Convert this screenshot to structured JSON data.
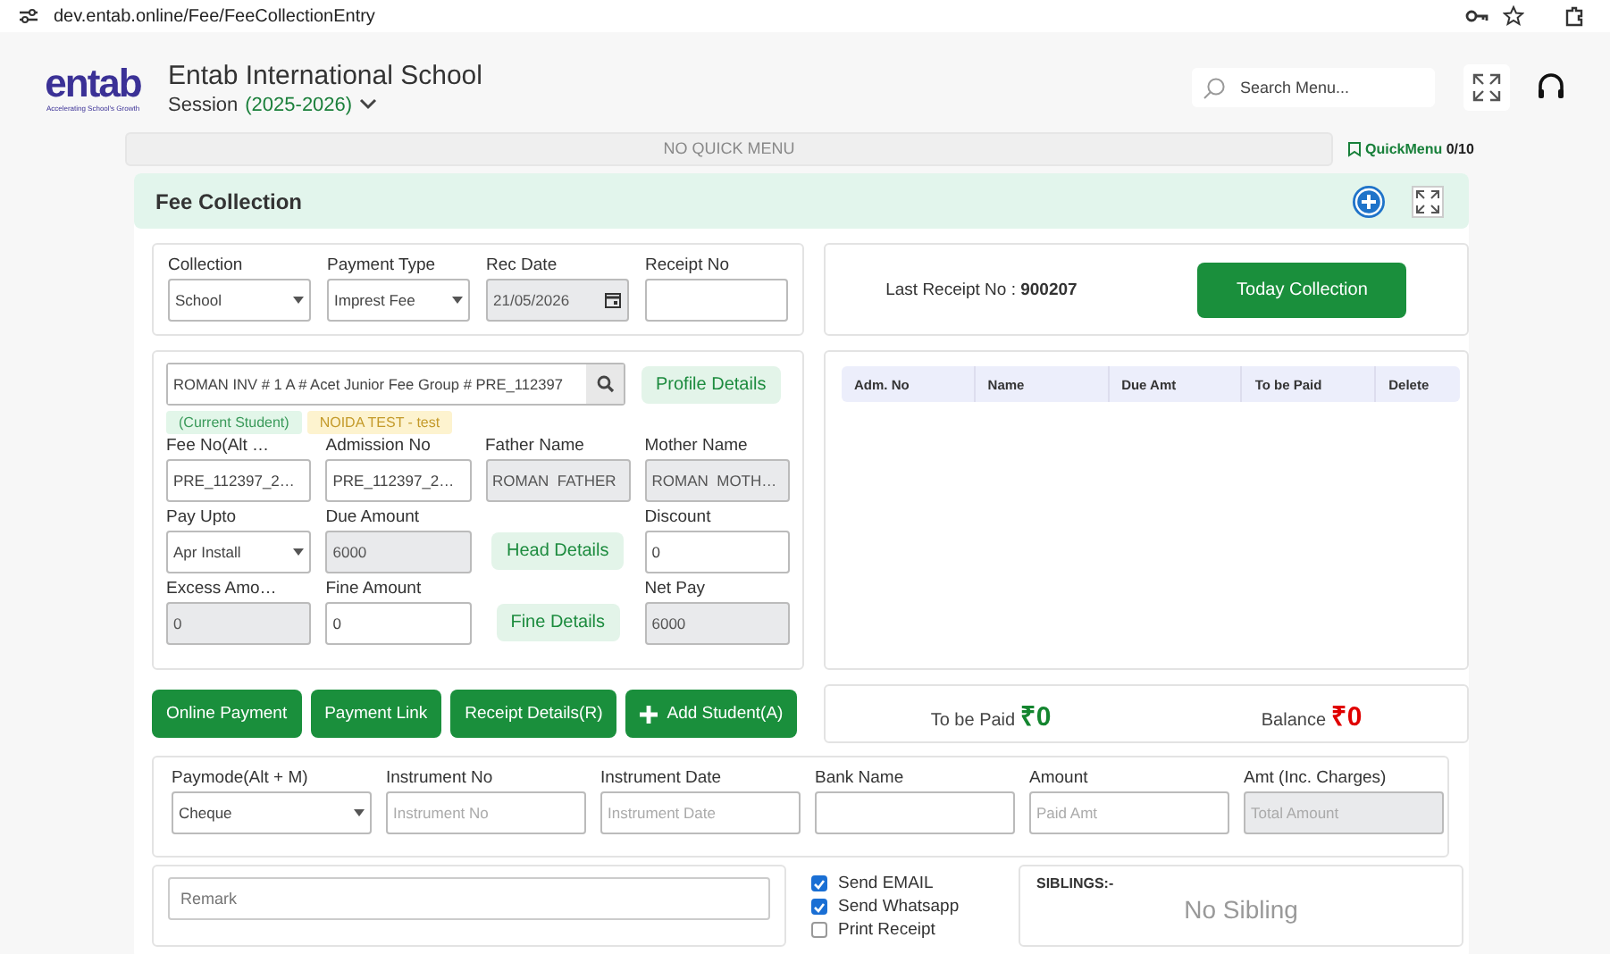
{
  "browser": {
    "url": "dev.entab.online/Fee/FeeCollectionEntry"
  },
  "header": {
    "logo": "entab",
    "tagline": "Accelerating School's Growth",
    "school": "Entab International School",
    "session_label": "Session",
    "session": "(2025-2026)",
    "search_placeholder": "Search Menu..."
  },
  "quick_menu": {
    "empty_text": "NO QUICK MENU",
    "label": "QuickMenu",
    "count": "0/10"
  },
  "panel": {
    "title": "Fee Collection"
  },
  "top_fields": [
    {
      "kind": "select",
      "label": "Collection",
      "value": "School"
    },
    {
      "kind": "select",
      "label": "Payment Type",
      "value": "Imprest Fee"
    },
    {
      "kind": "date",
      "label": "Rec Date",
      "value": "21/05/2026"
    },
    {
      "kind": "input",
      "label": "Receipt No"
    }
  ],
  "student_search": {
    "value": "ROMAN INV # 1 A # Acet Junior Fee Group # PRE_112397",
    "button": "Profile Details"
  },
  "tags": [
    {
      "text": "(Current Student)",
      "color": "#e2f6e9"
    },
    {
      "text": "NOIDA TEST - test",
      "color": "#fdf3cf"
    }
  ],
  "student_rows": [
    [
      {
        "kind": "input",
        "label": "Fee No(Alt …",
        "value": "PRE_112397_2…"
      },
      {
        "kind": "input",
        "label": "Admission No",
        "value": "PRE_112397_2…"
      },
      {
        "kind": "readonly",
        "label": "Father Name",
        "value": "ROMAN  FATHER"
      },
      {
        "kind": "readonly",
        "label": "Mother Name",
        "value": "ROMAN  MOTH…"
      }
    ],
    [
      {
        "kind": "select",
        "label": "Pay Upto",
        "value": "Apr Install"
      },
      {
        "kind": "readonly",
        "label": "Due Amount",
        "value": "6000"
      },
      {
        "kind": "button",
        "value": "Head Details"
      },
      {
        "kind": "input",
        "label": "Discount",
        "value": "0"
      }
    ],
    [
      {
        "kind": "readonly",
        "label": "Excess Amo…",
        "value": "0"
      },
      {
        "kind": "input",
        "label": "Fine Amount",
        "value": "0"
      },
      {
        "kind": "button",
        "value": "Fine Details"
      },
      {
        "kind": "readonly",
        "label": "Net Pay",
        "value": "6000"
      }
    ]
  ],
  "actions": [
    {
      "kind": "plain",
      "label": "Online Payment"
    },
    {
      "kind": "plain",
      "label": "Payment Link"
    },
    {
      "kind": "plain",
      "label": "Receipt Details(R)"
    },
    {
      "kind": "add",
      "label": "Add Student(A)"
    }
  ],
  "last_receipt": {
    "label": "Last Receipt No :",
    "number": "900207",
    "button": "Today Collection"
  },
  "table": {
    "columns": [
      "Adm. No",
      "Name",
      "Due Amt",
      "To be Paid",
      "Delete"
    ]
  },
  "totals": [
    {
      "label": "To be Paid",
      "value": "₹0",
      "color": "#14852f"
    },
    {
      "label": "Balance",
      "value": "₹0",
      "color": "#e00000"
    }
  ],
  "payment_fields": [
    {
      "kind": "select",
      "label": "Paymode(Alt + M)",
      "value": "Cheque"
    },
    {
      "kind": "input",
      "label": "Instrument No",
      "placeholder": "Instrument No"
    },
    {
      "kind": "input",
      "label": "Instrument Date",
      "placeholder": "Instrument Date"
    },
    {
      "kind": "input",
      "label": "Bank Name"
    },
    {
      "kind": "input",
      "label": "Amount",
      "placeholder": "Paid Amt"
    },
    {
      "kind": "readonly",
      "label": "Amt (Inc. Charges)",
      "placeholder": "Total Amount"
    }
  ],
  "remark": {
    "placeholder": "Remark"
  },
  "options": [
    {
      "label": "Send EMAIL",
      "checked": true
    },
    {
      "label": "Send Whatsapp",
      "checked": true
    },
    {
      "label": "Print Receipt",
      "checked": false
    }
  ],
  "siblings": {
    "title": "SIBLINGS:-",
    "empty_text": "No Sibling"
  }
}
